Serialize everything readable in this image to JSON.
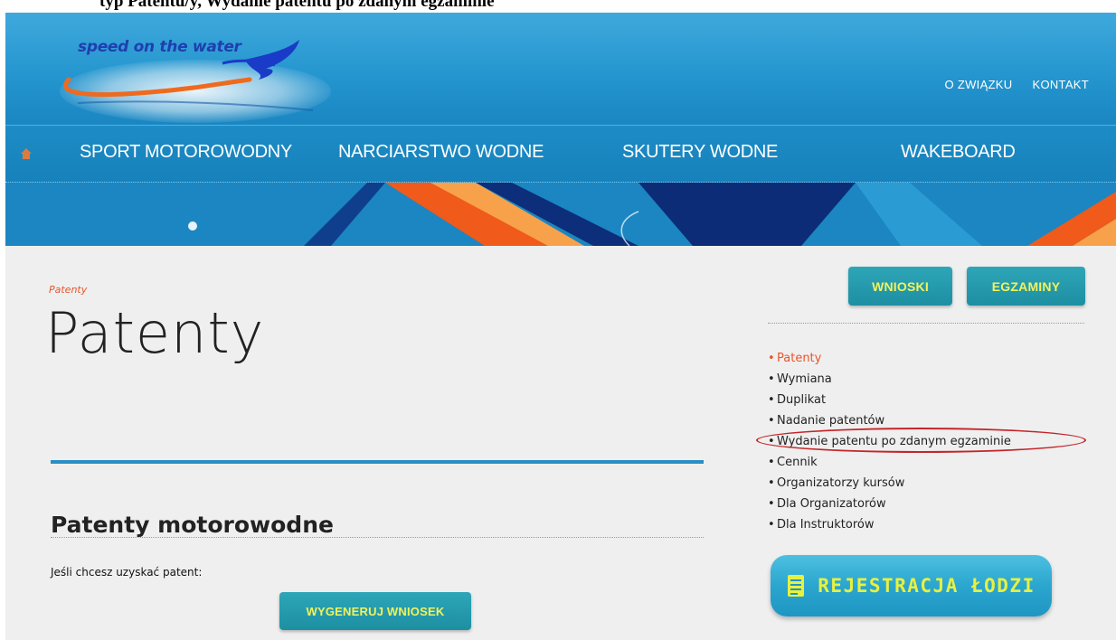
{
  "caption": {
    "text": "typ Patentu/y, Wydanie patentu po zdanym egzaminie"
  },
  "header": {
    "logo_text": "speed on the water",
    "top_links": [
      "O ZWIĄZKU",
      "KONTAKT"
    ]
  },
  "nav": {
    "items": [
      "SPORT MOTOROWODNY",
      "NARCIARSTWO WODNE",
      "SKUTERY WODNE",
      "WAKEBOARD"
    ]
  },
  "main": {
    "breadcrumb": "Patenty",
    "title": "Patenty",
    "section_title": "Patenty motorowodne",
    "intro": "Jeśli chcesz uzyskać patent:",
    "generate_button": "WYGENERUJ WNIOSEK"
  },
  "sidebar": {
    "buttons": [
      "WNIOSKI",
      "EGZAMINY"
    ],
    "items": [
      {
        "label": "Patenty",
        "active": true
      },
      {
        "label": "Wymiana",
        "active": false
      },
      {
        "label": "Duplikat",
        "active": false
      },
      {
        "label": "Nadanie patentów",
        "active": false
      },
      {
        "label": "Wydanie patentu po zdanym egzaminie",
        "active": false
      },
      {
        "label": "Cennik",
        "active": false
      },
      {
        "label": "Organizatorzy kursów",
        "active": false
      },
      {
        "label": "Dla Organizatorów",
        "active": false
      },
      {
        "label": "Dla Instruktorów",
        "active": false
      }
    ],
    "register_button": "REJESTRACJA ŁODZI"
  },
  "colors": {
    "header_blue": "#2596cf",
    "accent_orange": "#e8552a",
    "button_teal": "#1d8fa2",
    "button_text_yellow": "#f2f25a",
    "highlight_red": "#c4262a"
  },
  "icons": [
    "home-icon",
    "document-icon"
  ]
}
